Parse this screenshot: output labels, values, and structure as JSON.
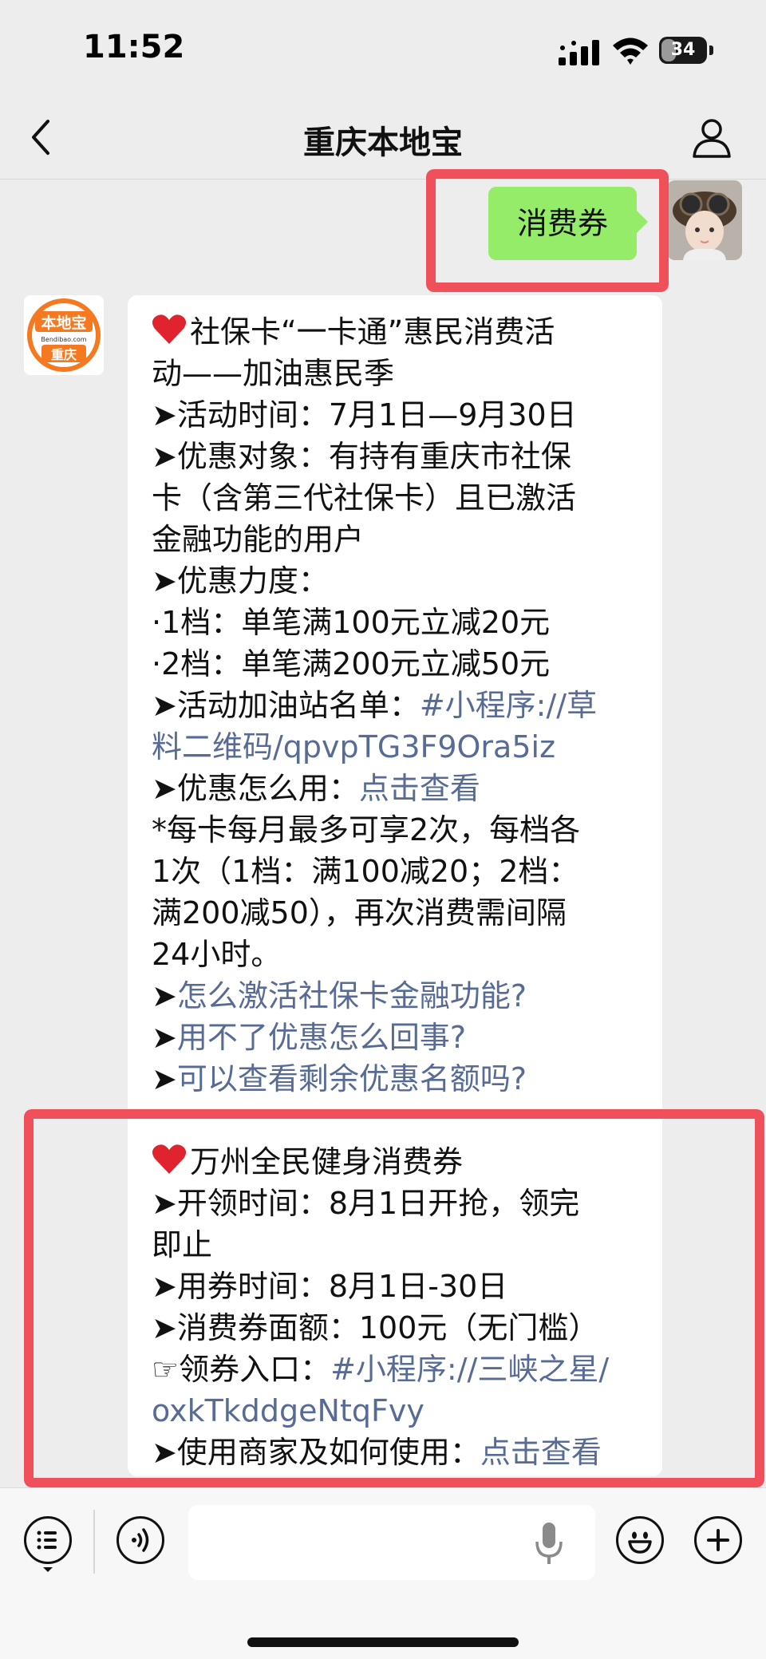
{
  "status_bar": {
    "time": "11:52",
    "battery": "34",
    "battery_level": 0.34
  },
  "nav": {
    "title": "重庆本地宝"
  },
  "outgoing_message": {
    "text": "消费券"
  },
  "brand_avatar": {
    "line1": "本地宝",
    "line2": "Bendibao.com",
    "line3": "重庆"
  },
  "incoming_message": {
    "l1": "社保卡“一卡通”惠民消费活",
    "l2": "动——加油惠民季",
    "l3": "➤活动时间：7月1日—9月30日",
    "l4": "➤优惠对象：有持有重庆市社保",
    "l5": "卡（含第三代社保卡）且已激活",
    "l6": "金融功能的用户",
    "l7": "➤优惠力度：",
    "l8": "·1档：单笔满100元立减20元",
    "l9": "·2档：单笔满200元立减50元",
    "l10_prefix": "➤活动加油站名单：",
    "l10_link": "#小程序://草",
    "l11_link": "料二维码/qpvpTG3F9Ora5iz",
    "l12_prefix": "➤优惠怎么用：",
    "l12_link": "点击查看",
    "l13": "*每卡每月最多可享2次，每档各",
    "l14": "1次（1档：满100减20；2档：",
    "l15": "满200减50），再次消费需间隔",
    "l16": "24小时。",
    "l17_prefix": "➤",
    "l17_link": "怎么激活社保卡金融功能?",
    "l18_prefix": "➤",
    "l18_link": "用不了优惠怎么回事?",
    "l19_prefix": "➤",
    "l19_link": "可以查看剩余优惠名额吗?",
    "l20": "",
    "l21": "万州全民健身消费券",
    "l22": "➤开领时间：8月1日开抢，领完",
    "l23": "即止",
    "l24": "➤用券时间：8月1日-30日",
    "l25": "➤消费券面额：100元（无门槛）",
    "l26_prefix": "☞领券入口：",
    "l26_link": "#小程序://三峡之星/",
    "l27_link": "oxkTkddgeNtqFvy",
    "l28_prefix": "➤使用商家及如何使用：",
    "l28_link": "点击查看"
  },
  "colors": {
    "accent_highlight": "#f0505a",
    "bubble_out": "#95ec69",
    "link": "#576b95"
  }
}
